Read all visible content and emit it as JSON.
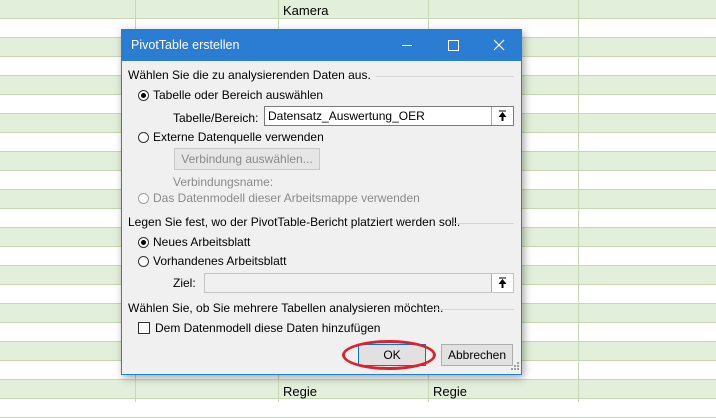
{
  "sheet": {
    "cells": [
      {
        "id": "kamera",
        "text": "Kamera"
      },
      {
        "id": "regie1",
        "text": "Regie"
      },
      {
        "id": "regie2",
        "text": "Regie"
      }
    ]
  },
  "dialog": {
    "title": "PivotTable erstellen",
    "section1": "Wählen Sie die zu analysierenden Daten aus.",
    "opt_table": "Tabelle oder Bereich auswählen",
    "table_label": "Tabelle/Bereich:",
    "table_value": "Datensatz_Auswertung_OER",
    "opt_external": "Externe Datenquelle verwenden",
    "connect_button": "Verbindung auswählen...",
    "connection_name_label": "Verbindungsname:",
    "opt_datamodel": "Das Datenmodell dieser Arbeitsmappe verwenden",
    "section2": "Legen Sie fest, wo der PivotTable-Bericht platziert werden soll.",
    "opt_new_sheet": "Neues Arbeitsblatt",
    "opt_existing_sheet": "Vorhandenes Arbeitsblatt",
    "target_label": "Ziel:",
    "target_value": "",
    "section3": "Wählen Sie, ob Sie mehrere Tabellen analysieren möchten.",
    "add_to_model": "Dem Datenmodell diese Daten hinzufügen",
    "ok": "OK",
    "cancel": "Abbrechen"
  },
  "colors": {
    "titlebar": "#2b7cd3",
    "sheet_band": "#e2efda",
    "highlight": "#e0202a"
  }
}
